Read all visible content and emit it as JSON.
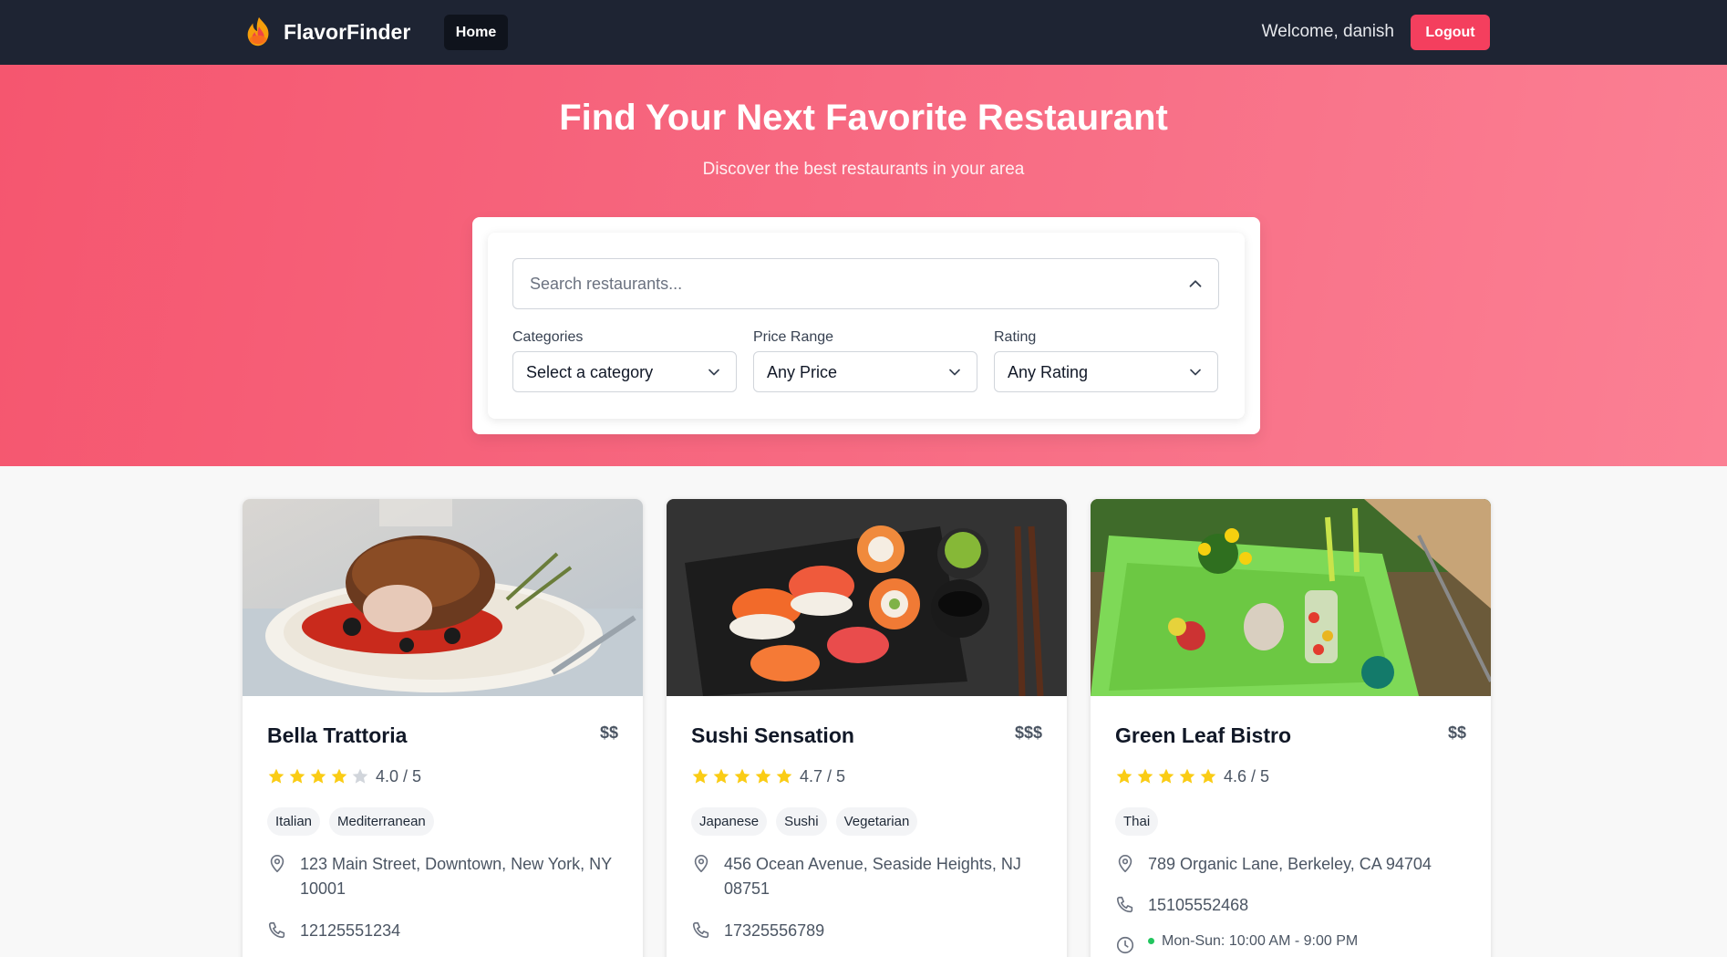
{
  "nav": {
    "brand": "FlavorFinder",
    "home_label": "Home",
    "welcome": "Welcome, danish",
    "logout_label": "Logout"
  },
  "hero": {
    "title": "Find Your Next Favorite Restaurant",
    "subtitle": "Discover the best restaurants in your area"
  },
  "search": {
    "placeholder": "Search restaurants...",
    "value": "",
    "filters": [
      {
        "label": "Categories",
        "value": "Select a category"
      },
      {
        "label": "Price Range",
        "value": "Any Price"
      },
      {
        "label": "Rating",
        "value": "Any Rating"
      }
    ]
  },
  "colors": {
    "accent": "#f43f5e",
    "navbar": "#1e2433",
    "star": "#facc15",
    "star_empty": "#d1d5db",
    "open_dot": "#22c55e"
  },
  "restaurants": [
    {
      "name": "Bella Trattoria",
      "price": "$$",
      "rating": 4.0,
      "rating_text": "4.0 / 5",
      "tags": [
        "Italian",
        "Mediterranean"
      ],
      "address": "123 Main Street, Downtown, New York, NY 10001",
      "phone": "12125551234"
    },
    {
      "name": "Sushi Sensation",
      "price": "$$$",
      "rating": 4.7,
      "rating_text": "4.7 / 5",
      "tags": [
        "Japanese",
        "Sushi",
        "Vegetarian"
      ],
      "address": "456 Ocean Avenue, Seaside Heights, NJ 08751",
      "phone": "17325556789"
    },
    {
      "name": "Green Leaf Bistro",
      "price": "$$",
      "rating": 4.6,
      "rating_text": "4.6 / 5",
      "tags": [
        "Thai"
      ],
      "address": "789 Organic Lane, Berkeley, CA 94704",
      "phone": "15105552468",
      "hours": "Mon-Sun: 10:00 AM - 9:00 PM"
    }
  ],
  "icons": {
    "brand": "flame-logo-icon",
    "location": "location-pin-icon",
    "phone": "phone-icon",
    "clock": "clock-icon",
    "search_toggle": "chevron-up-icon",
    "select": "chevron-down-icon",
    "star": "star-icon"
  }
}
